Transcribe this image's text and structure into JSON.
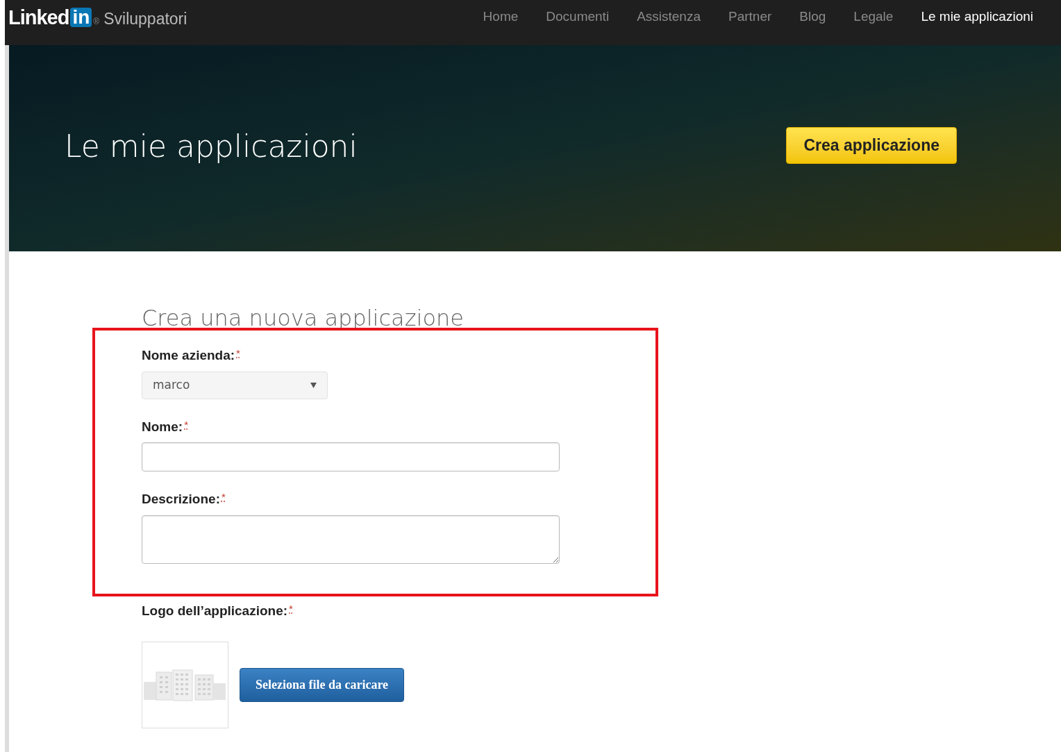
{
  "header": {
    "logo_text": "Linked",
    "logo_badge": "in",
    "logo_mark": "®",
    "site_name": "Sviluppatori",
    "nav": [
      {
        "label": "Home",
        "selected": false
      },
      {
        "label": "Documenti",
        "selected": false
      },
      {
        "label": "Assistenza",
        "selected": false
      },
      {
        "label": "Partner",
        "selected": false
      },
      {
        "label": "Blog",
        "selected": false
      },
      {
        "label": "Legale",
        "selected": false
      },
      {
        "label": "Le mie applicazioni",
        "selected": true
      }
    ]
  },
  "hero": {
    "title": "Le mie applicazioni",
    "button": "Crea applicazione"
  },
  "form": {
    "title": "Crea una nuova applicazione",
    "fields": [
      {
        "kind": "select",
        "label": "Nome azienda:",
        "required_mark": "*",
        "value": "marco"
      },
      {
        "kind": "text",
        "label": "Nome:",
        "required_mark": "*"
      },
      {
        "kind": "textarea",
        "label": "Descrizione:",
        "required_mark": "*"
      },
      {
        "kind": "file",
        "label": "Logo dell’applicazione:",
        "required_mark": "*",
        "button": "Seleziona file da caricare"
      }
    ]
  }
}
